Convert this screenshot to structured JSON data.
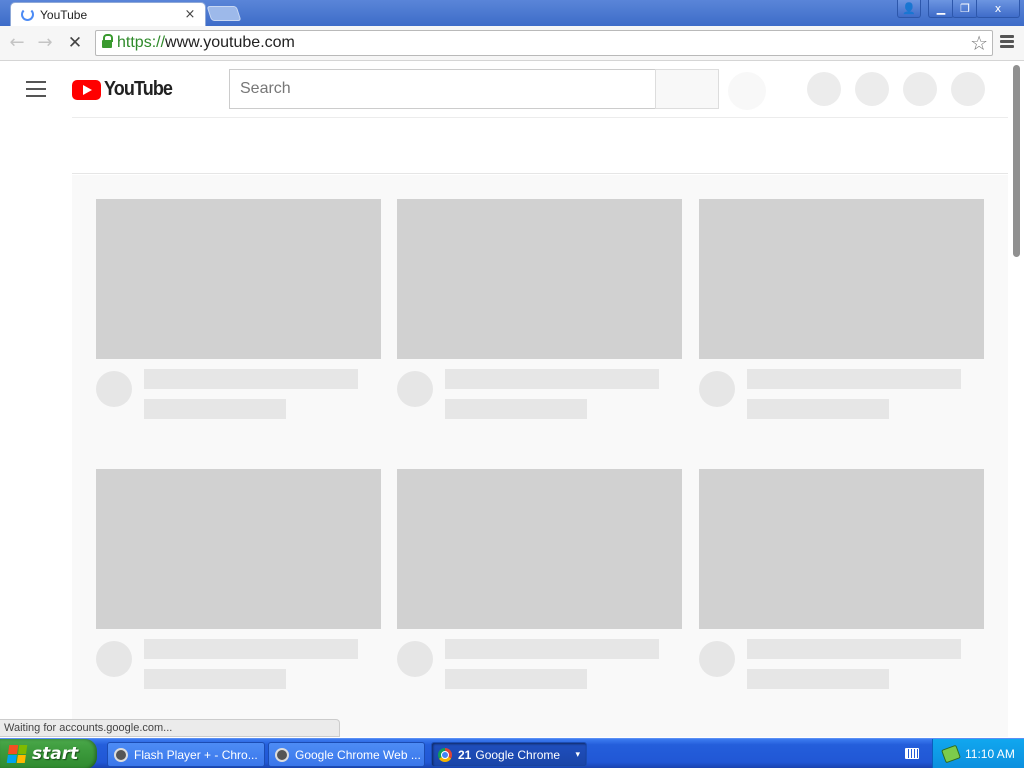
{
  "browser": {
    "tab": {
      "title": "YouTube",
      "close": "×"
    },
    "window_controls": {
      "profile": "👤",
      "minimize": "▁",
      "maximize": "❐",
      "close": "x"
    },
    "nav": {
      "back": "←",
      "forward": "→",
      "stop": "✕"
    },
    "omnibox": {
      "scheme": "https://",
      "rest": "www.youtube.com",
      "bookmark": "☆"
    },
    "status_text": "Waiting for accounts.google.com..."
  },
  "youtube": {
    "logo_text": "YouTube",
    "search": {
      "placeholder": "Search"
    },
    "colors": {
      "brand": "#ff0000",
      "placeholder_thumb": "#d1d1d1",
      "placeholder_line": "#e6e6e6"
    },
    "video_rows": 2,
    "video_cols": 3
  },
  "taskbar": {
    "start_label": "start",
    "tasks": [
      {
        "label": "Flash Player + - Chro...",
        "icon": "raccoon-icon"
      },
      {
        "label": "Google Chrome Web ...",
        "icon": "raccoon-icon"
      },
      {
        "count": "21",
        "label": "Google Chrome",
        "icon": "chrome-icon",
        "caret": "▾"
      }
    ],
    "clock": "11:10 AM"
  }
}
